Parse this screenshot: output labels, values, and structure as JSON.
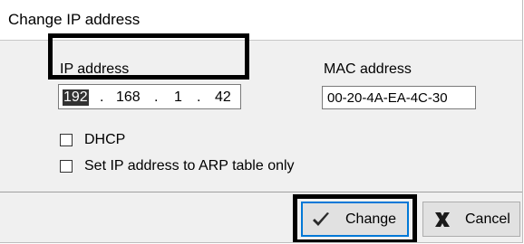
{
  "dialog": {
    "title": "Change IP address"
  },
  "ip": {
    "label": "IP address",
    "octets": [
      "192",
      "168",
      "1",
      "42"
    ],
    "separator": "."
  },
  "mac": {
    "label": "MAC address",
    "value": "00-20-4A-EA-4C-30"
  },
  "options": {
    "dhcp_label": "DHCP",
    "dhcp_checked": false,
    "arp_label": "Set IP address to ARP table only",
    "arp_checked": false
  },
  "buttons": {
    "change_label": "Change",
    "change_icon": "checkmark-icon",
    "cancel_label": "Cancel",
    "cancel_icon": "close-x-icon"
  },
  "colors": {
    "dialog_bg": "#f0f0f0",
    "selection_bg": "#333333",
    "default_button_border": "#0078d7",
    "callout_border": "#000000"
  }
}
